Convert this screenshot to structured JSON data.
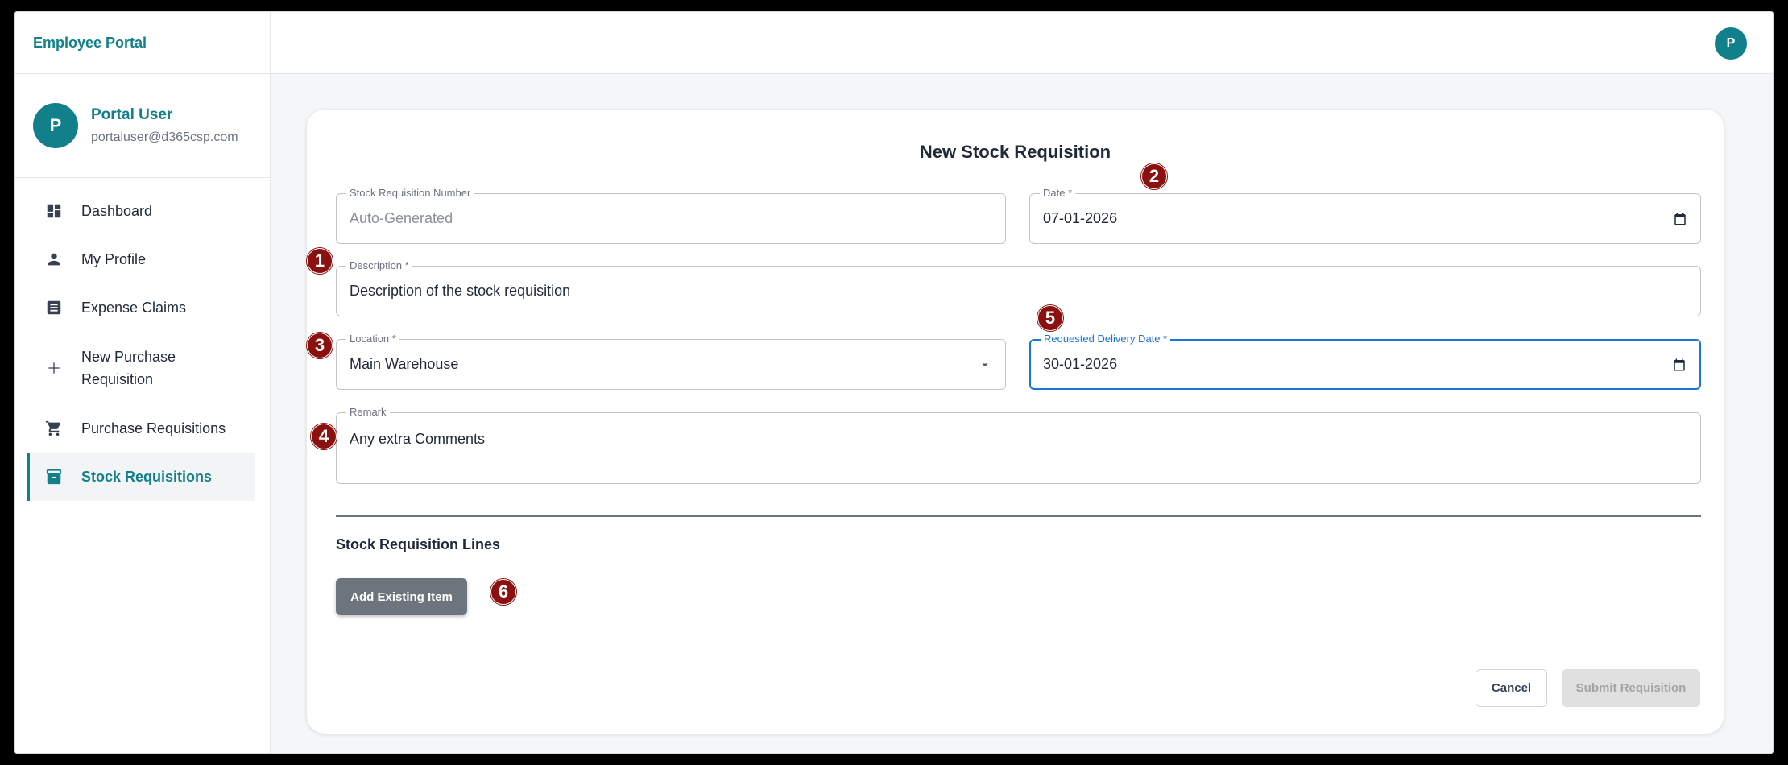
{
  "app": {
    "title": "Employee Portal",
    "accent": "#12808a"
  },
  "user": {
    "initial": "P",
    "name": "Portal User",
    "email": "portaluser@d365csp.com"
  },
  "sidebar": {
    "items": [
      {
        "label": "Dashboard",
        "icon": "dashboard-icon"
      },
      {
        "label": "My Profile",
        "icon": "person-icon"
      },
      {
        "label": "Expense Claims",
        "icon": "document-icon"
      },
      {
        "label": "New Purchase Requisition",
        "icon": "plus-icon"
      },
      {
        "label": "Purchase Requisitions",
        "icon": "cart-icon"
      },
      {
        "label": "Stock Requisitions",
        "icon": "archive-icon",
        "active": true
      }
    ]
  },
  "form": {
    "title": "New Stock Requisition",
    "number": {
      "label": "Stock Requisition Number",
      "placeholder": "Auto-Generated"
    },
    "date": {
      "label": "Date *",
      "value": "07-01-2026"
    },
    "description": {
      "label": "Description *",
      "value": "Description of the stock requisition"
    },
    "location": {
      "label": "Location *",
      "value": "Main Warehouse"
    },
    "delivery_date": {
      "label": "Requested Delivery Date *",
      "value": "30-01-2026"
    },
    "remark": {
      "label": "Remark",
      "value": "Any extra Comments"
    },
    "lines_title": "Stock Requisition Lines",
    "add_item_label": "Add Existing Item",
    "cancel_label": "Cancel",
    "submit_label": "Submit Requisition"
  },
  "annotations": [
    "1",
    "2",
    "3",
    "4",
    "5",
    "6"
  ]
}
